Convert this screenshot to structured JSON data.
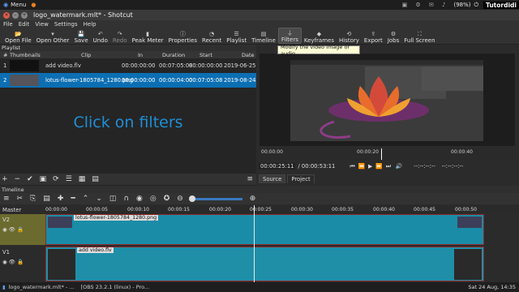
{
  "system_bar": {
    "menu_label": "Menu",
    "battery": "(98%)",
    "brand": "Tutordidi"
  },
  "window": {
    "title": "logo_watermark.mlt* - Shotcut"
  },
  "menu": [
    "File",
    "Edit",
    "View",
    "Settings",
    "Help"
  ],
  "toolbar": [
    {
      "label": "Open File",
      "icon": "open-file-icon"
    },
    {
      "label": "Open Other",
      "icon": "open-other-icon"
    },
    {
      "label": "Save",
      "icon": "save-icon"
    },
    {
      "label": "Undo",
      "icon": "undo-icon"
    },
    {
      "label": "Redo",
      "icon": "redo-icon"
    },
    {
      "label": "Peak Meter",
      "icon": "peak-meter-icon"
    },
    {
      "label": "Properties",
      "icon": "properties-icon"
    },
    {
      "label": "Recent",
      "icon": "recent-icon"
    },
    {
      "label": "Playlist",
      "icon": "playlist-icon"
    },
    {
      "label": "Timeline",
      "icon": "timeline-icon"
    },
    {
      "label": "Filters",
      "icon": "filter-icon"
    },
    {
      "label": "Keyframes",
      "icon": "keyframes-icon"
    },
    {
      "label": "History",
      "icon": "history-icon"
    },
    {
      "label": "Export",
      "icon": "export-icon"
    },
    {
      "label": "Jobs",
      "icon": "jobs-icon"
    },
    {
      "label": "Full Screen",
      "icon": "full-screen-icon"
    }
  ],
  "tooltip": "Modify the video image or audio",
  "playlist": {
    "title": "Playlist",
    "columns": [
      "#",
      "Thumbnails",
      "Clip",
      "In",
      "Duration",
      "Start",
      "Date"
    ],
    "rows": [
      {
        "num": "1",
        "clip": "add video.flv",
        "in": "00:00:00:00",
        "duration": "00:07:05:08",
        "start": "00:00:00:00",
        "date": "2019-06-25"
      },
      {
        "num": "2",
        "clip": "lotus-flower-1805784_1280.png",
        "in": "00:00:00:00",
        "duration": "00:00:04:00",
        "start": "00:07:05:08",
        "date": "2019-08-24"
      }
    ],
    "overlay_text": "Click on filters"
  },
  "player": {
    "ruler_ticks": [
      "00:00:00",
      "00:00:20",
      "00:00:40"
    ],
    "current_time": "00:00:25:11",
    "total_time": "/ 00:00:53:11",
    "in_point": "--:--:--:--",
    "out_point": "--:--:--:--",
    "tabs": [
      "Source",
      "Project"
    ]
  },
  "timeline": {
    "title": "Timeline",
    "ticks": [
      "00:00:00",
      "00:00:05",
      "00:00:10",
      "00:00:15",
      "00:00:20",
      "00:00:25",
      "00:00:30",
      "00:00:35",
      "00:00:40",
      "00:00:45",
      "00:00:50"
    ],
    "tracks": [
      {
        "name": "Master"
      },
      {
        "name": "V2",
        "clip": "lotus-flower-1805784_1280.png"
      },
      {
        "name": "V1",
        "clip": "add video.flv"
      }
    ]
  },
  "taskbar": {
    "items": [
      "logo_watermark.mlt* - ...",
      "[OBS 23.2.1 (linux) - Pro..."
    ],
    "time": "Sat 24 Aug, 14:35"
  }
}
